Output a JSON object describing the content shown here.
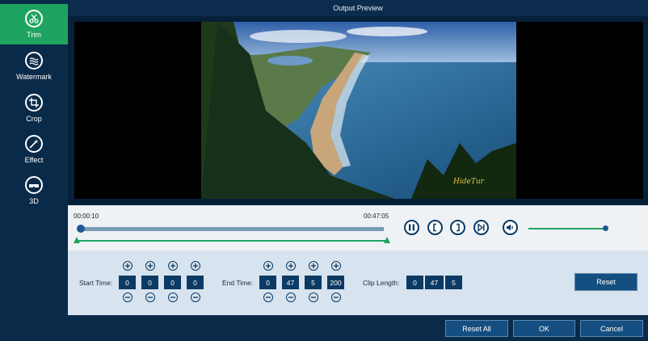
{
  "sidebar": {
    "items": [
      {
        "label": "Trim"
      },
      {
        "label": "Watermark"
      },
      {
        "label": "Crop"
      },
      {
        "label": "Effect"
      },
      {
        "label": "3D"
      }
    ]
  },
  "window": {
    "title": "Output Preview"
  },
  "playback": {
    "current_time": "00:00:10",
    "total_time": "00:47:05",
    "volume": 0.95
  },
  "trim": {
    "start_label": "Start Time:",
    "start": [
      "0",
      "0",
      "0",
      "0"
    ],
    "end_label": "End Time:",
    "end": [
      "0",
      "47",
      "5",
      "200"
    ],
    "clip_label": "Clip Length:",
    "clip": [
      "0",
      "47",
      "5"
    ]
  },
  "buttons": {
    "reset": "Reset",
    "reset_all": "Reset All",
    "ok": "OK",
    "cancel": "Cancel"
  },
  "video": {
    "watermark_text": "HideTur"
  },
  "colors": {
    "accent": "#1ea460",
    "primary": "#154e80",
    "dark": "#0a2a4a"
  }
}
